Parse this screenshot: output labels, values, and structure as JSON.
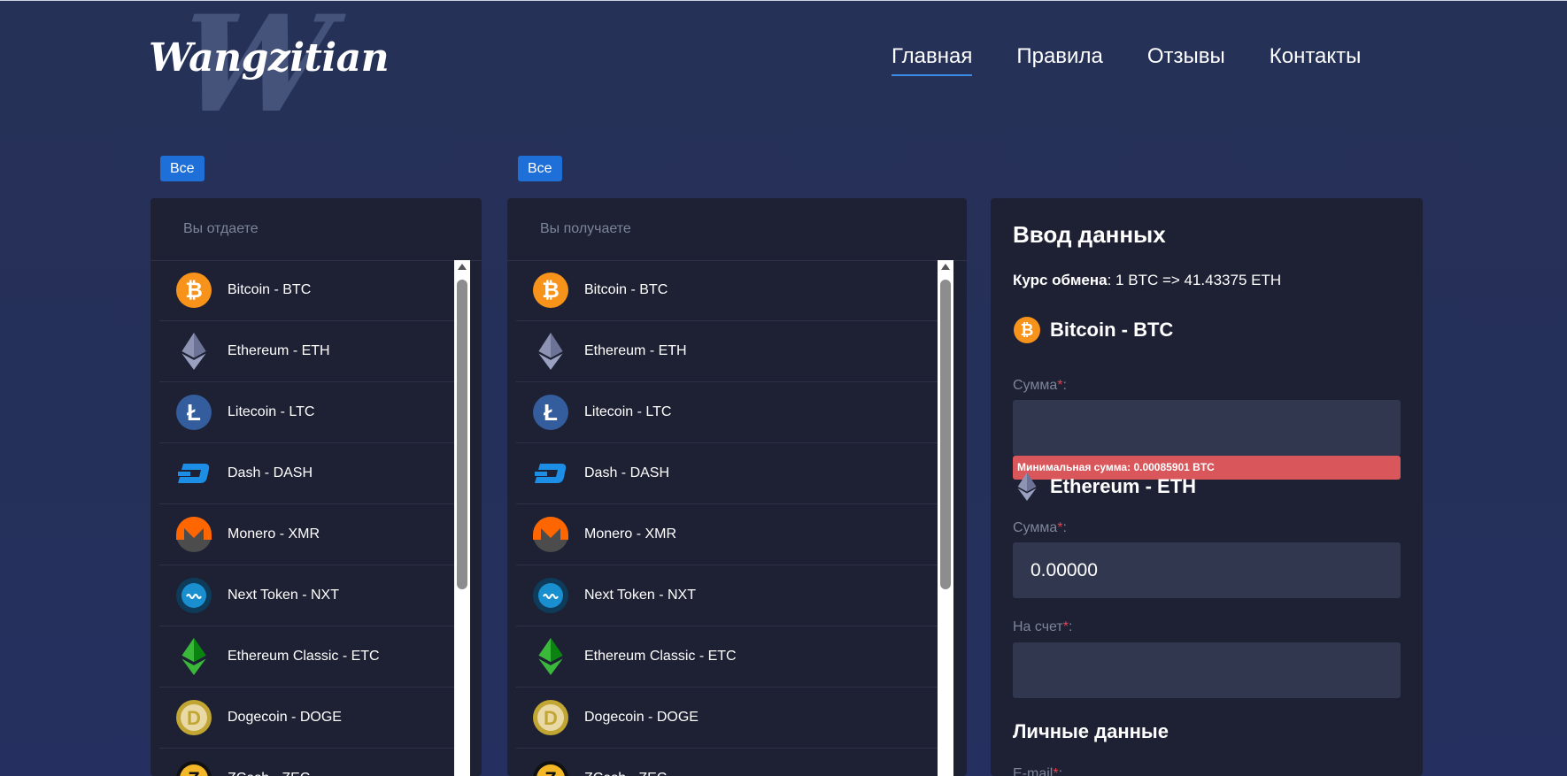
{
  "brand": {
    "name": "Wangzitian",
    "monogram": "W"
  },
  "nav": {
    "items": [
      "Главная",
      "Правила",
      "Отзывы",
      "Контакты"
    ],
    "active_index": 0
  },
  "filters": {
    "give_chip": "Все",
    "get_chip": "Все"
  },
  "give_panel": {
    "header": "Вы отдаете"
  },
  "get_panel": {
    "header": "Вы получаете"
  },
  "coins": [
    {
      "label": "Bitcoin - BTC",
      "icon": "bitcoin-icon"
    },
    {
      "label": "Ethereum - ETH",
      "icon": "ethereum-icon"
    },
    {
      "label": "Litecoin - LTC",
      "icon": "litecoin-icon"
    },
    {
      "label": "Dash - DASH",
      "icon": "dash-icon"
    },
    {
      "label": "Monero - XMR",
      "icon": "monero-icon"
    },
    {
      "label": "Next Token - NXT",
      "icon": "nxt-icon"
    },
    {
      "label": "Ethereum Classic - ETC",
      "icon": "ethereum-classic-icon"
    },
    {
      "label": "Dogecoin - DOGE",
      "icon": "dogecoin-icon"
    },
    {
      "label": "ZCash - ZEC",
      "icon": "zcash-icon"
    }
  ],
  "form": {
    "title": "Ввод данных",
    "rate_label": "Курс обмена",
    "rate_value": ": 1 BTC => 41.43375 ETH",
    "give_currency": "Bitcoin - BTC",
    "give_amount_label": "Сумма",
    "give_amount_value": "",
    "error_min": "Минимальная сумма: 0.00085901 BTC",
    "get_currency": "Ethereum - ETH",
    "get_amount_label": "Сумма",
    "get_amount_value": "0.00000",
    "account_label": "На счет",
    "account_value": "",
    "required_mark": "*",
    "personal_title": "Личные данные",
    "email_label": "E-mail"
  },
  "colors": {
    "accent": "#1f6fd8",
    "panel": "#1d2133",
    "field": "#323750",
    "error": "#d9575b",
    "bitcoin": "#f7931a"
  }
}
